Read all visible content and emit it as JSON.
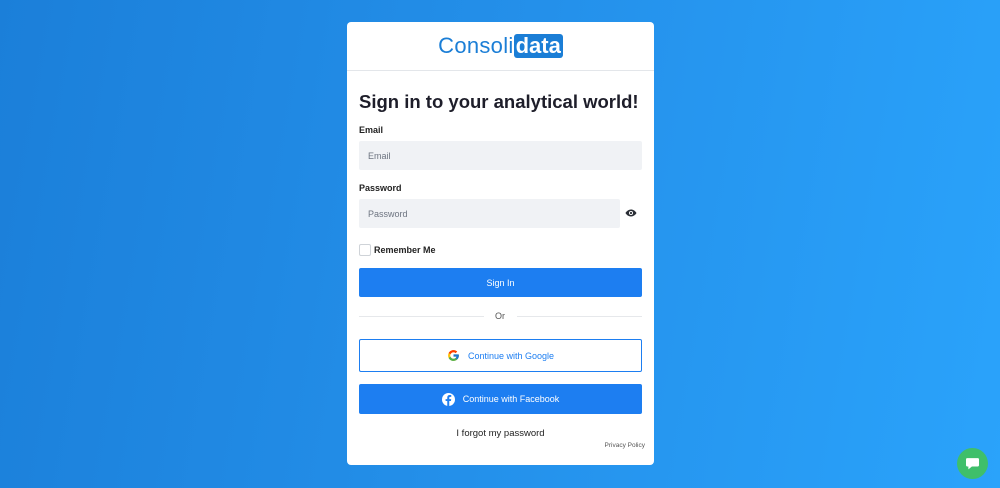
{
  "brand": {
    "part1": "Consoli",
    "part2": "data"
  },
  "form": {
    "title": "Sign in to your analytical world!",
    "email_label": "Email",
    "email_placeholder": "Email",
    "password_label": "Password",
    "password_placeholder": "Password",
    "remember_label": "Remember Me",
    "signin_label": "Sign In",
    "or_label": "Or",
    "google_label": "Continue with Google",
    "facebook_label": "Continue with Facebook",
    "forgot_label": "I forgot my password",
    "privacy_label": "Privacy Policy"
  },
  "icons": {
    "password_toggle": "eye-icon",
    "google": "google-icon",
    "facebook": "facebook-icon",
    "chat": "chat-icon"
  },
  "colors": {
    "primary": "#1d7ef1",
    "brand": "#1b7ed6",
    "chat": "#3fbf6a"
  }
}
